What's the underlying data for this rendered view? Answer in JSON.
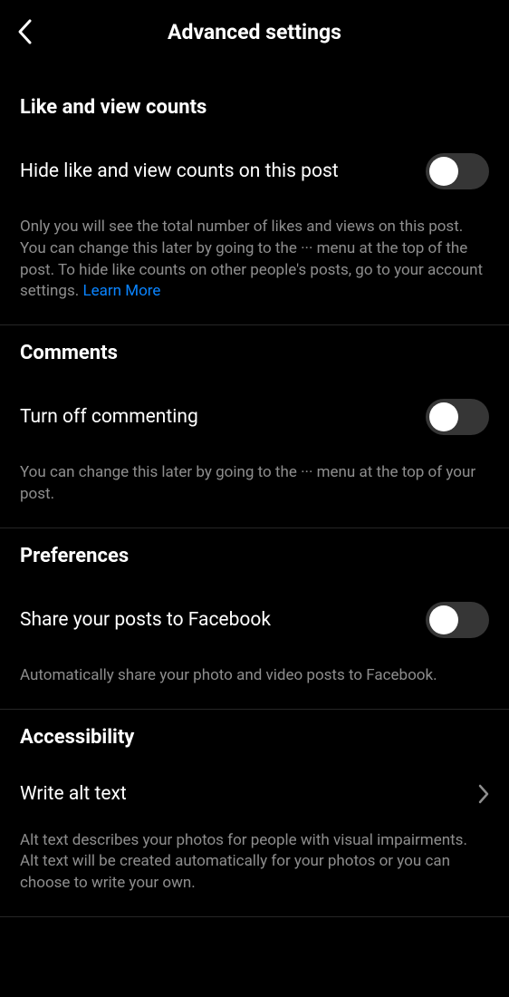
{
  "header": {
    "title": "Advanced settings"
  },
  "sections": {
    "likes": {
      "heading": "Like and view counts",
      "toggle_label": "Hide like and view counts on this post",
      "description_pre": "Only you will see the total number of likes and views on this post. You can change this later by going to the ··· menu at the top of the post. To hide like counts on other people's posts, go to your account settings. ",
      "learn_more": "Learn More"
    },
    "comments": {
      "heading": "Comments",
      "toggle_label": "Turn off commenting",
      "description": "You can change this later by going to the ··· menu at the top of your post."
    },
    "preferences": {
      "heading": "Preferences",
      "toggle_label": "Share your posts to Facebook",
      "description": "Automatically share your photo and video posts to Facebook."
    },
    "accessibility": {
      "heading": "Accessibility",
      "nav_label": "Write alt text",
      "description": "Alt text describes your photos for people with visual impairments. Alt text will be created automatically for your photos or you can choose to write your own."
    }
  }
}
